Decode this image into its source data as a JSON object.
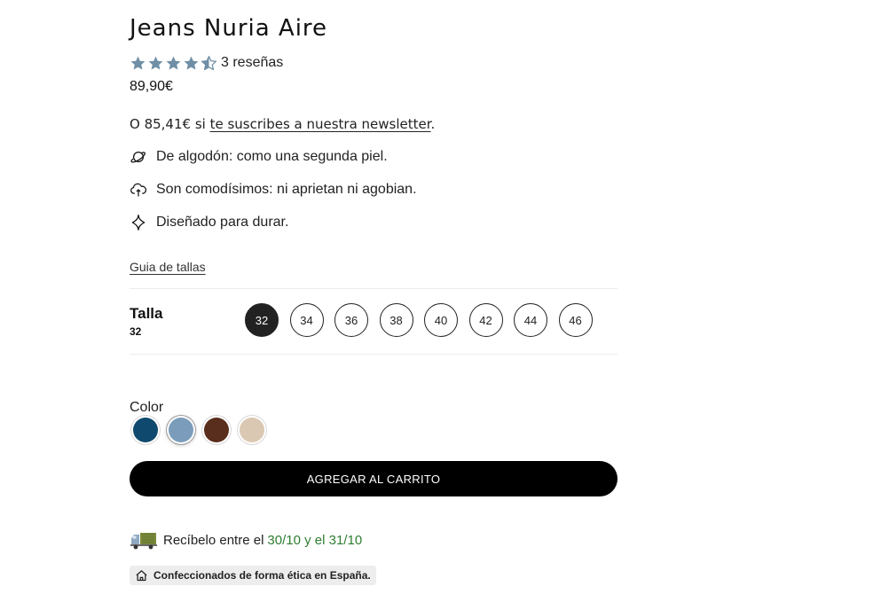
{
  "product": {
    "title": "Jeans Nuria Aire",
    "rating": 4.5,
    "rating_max": 5,
    "reviews_label": "3 reseñas",
    "price": "89,90€",
    "star_color": "#6f8fa6"
  },
  "newsletter": {
    "prefix": "O 85,41€ si ",
    "link": "te suscribes a nuestra newsletter",
    "suffix": "."
  },
  "features": [
    {
      "icon": "planet-icon",
      "text": "De algodón: como una segunda piel."
    },
    {
      "icon": "cloud-icon",
      "text": "Son comodísimos: ni aprietan ni agobian."
    },
    {
      "icon": "sparkle-icon",
      "text": "Diseñado para durar."
    }
  ],
  "size_guide": "Guia de tallas",
  "size": {
    "label": "Talla",
    "selected": "32",
    "options": [
      "32",
      "34",
      "36",
      "38",
      "40",
      "42",
      "44",
      "46"
    ]
  },
  "color": {
    "label": "Color",
    "selected_index": 1,
    "swatches": [
      "#0f4a6e",
      "#7b9dbb",
      "#5a2e1c",
      "#dac8b2"
    ]
  },
  "cart_button": "AGREGAR AL CARRITO",
  "delivery": {
    "prefix": "Recíbelo entre el",
    "dates": "30/10 y el 31/10",
    "accent": "#2e7d32"
  },
  "ethic_badge": "Confeccionados de forma ética en España."
}
